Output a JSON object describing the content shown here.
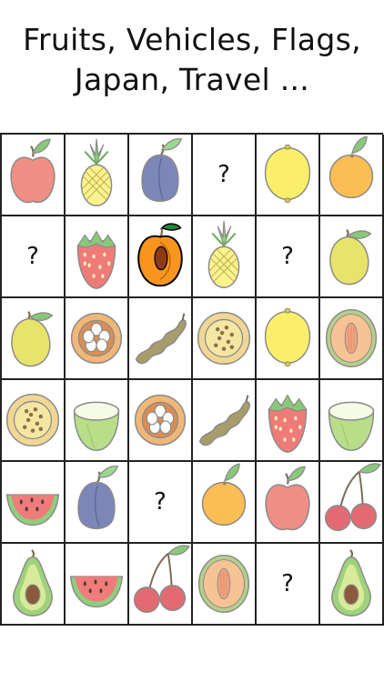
{
  "headline": {
    "line1": "Fruits, Vehicles, Flags,",
    "line2": "Japan, Travel ..."
  },
  "board": {
    "hidden_symbol": "?",
    "rows": [
      [
        "apple",
        "pineapple",
        "plum",
        "hidden",
        "lemon",
        "orange"
      ],
      [
        "hidden",
        "strawberry",
        "peach",
        "pineapple",
        "hidden",
        "mango"
      ],
      [
        "mango",
        "mangosteen",
        "tamarind",
        "passionfruit",
        "lemon",
        "melon"
      ],
      [
        "passionfruit",
        "coconut",
        "mangosteen",
        "tamarind",
        "strawberry",
        "coconut"
      ],
      [
        "watermelon",
        "plum",
        "hidden",
        "orange",
        "apple",
        "cherry"
      ],
      [
        "avocado",
        "watermelon",
        "cherry",
        "melon",
        "hidden",
        "avocado"
      ]
    ],
    "selected": {
      "row": 1,
      "col": 2
    }
  }
}
